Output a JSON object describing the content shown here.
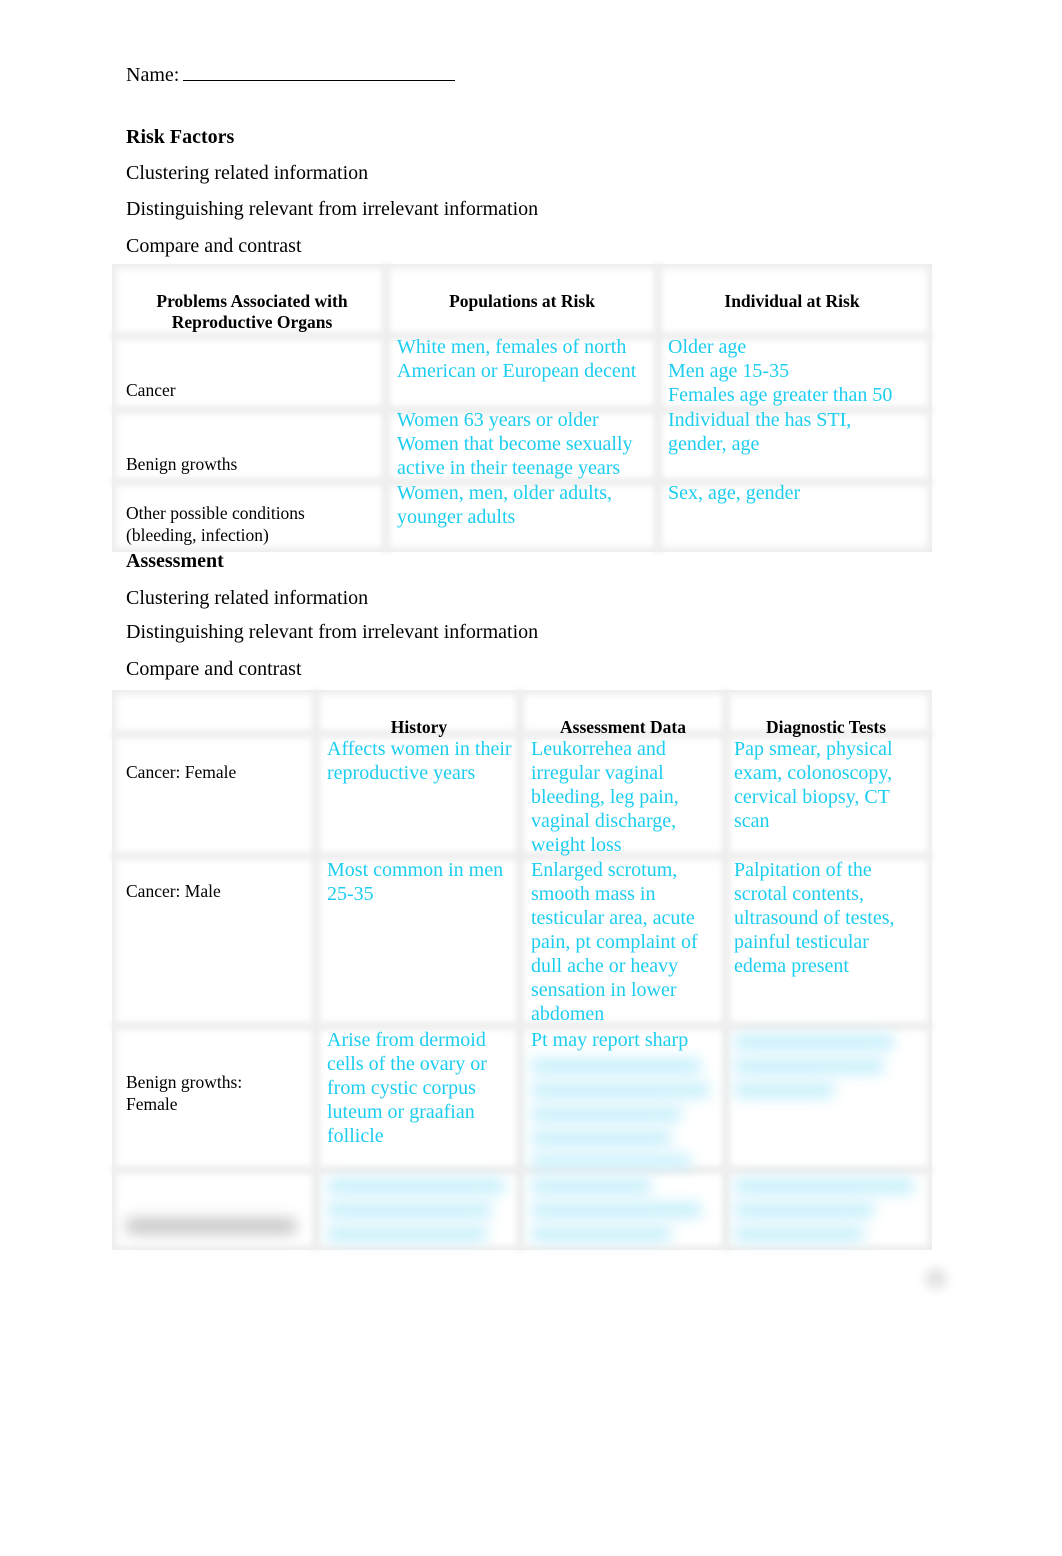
{
  "document": {
    "name_label": "Name:",
    "risk_factors": {
      "heading": "Risk Factors",
      "bullets": [
        "Clustering related information",
        "Distinguishing relevant from irrelevant information",
        "Compare and contrast"
      ],
      "table": {
        "headers": [
          "Problems Associated with Reproductive Organs",
          "Populations at Risk",
          "Individual at Risk"
        ],
        "rows": [
          {
            "problem": "Cancer",
            "populations": [
              "White men, females of north",
              "American or European decent"
            ],
            "individual": [
              "Older age",
              "Men age 15-35",
              "Females age greater than 50"
            ]
          },
          {
            "problem": "Benign growths",
            "populations": [
              "Women 63 years or older",
              "Women that become sexually",
              "active in their teenage years"
            ],
            "individual": [
              "Individual the has STI,",
              "gender, age"
            ]
          },
          {
            "problem": "Other possible conditions (bleeding, infection)",
            "populations": [
              "Women, men, older adults,",
              "younger adults"
            ],
            "individual": [
              "Sex, age, gender"
            ]
          }
        ]
      }
    },
    "assessment": {
      "heading": "Assessment",
      "bullets": [
        "Clustering related information",
        "Distinguishing relevant from irrelevant information",
        "Compare and contrast"
      ],
      "table": {
        "headers": [
          "",
          "History",
          "Assessment Data",
          "Diagnostic Tests"
        ],
        "rows": [
          {
            "condition": "Cancer: Female",
            "history": "Affects women in their reproductive years",
            "assessment": "Leukorrehea and irregular vaginal bleeding, leg pain, vaginal discharge, weight loss",
            "tests": "Pap smear, physical exam, colonoscopy, cervical biopsy, CT scan"
          },
          {
            "condition": "Cancer: Male",
            "history": "Most common in men 25-35",
            "assessment": "Enlarged scrotum, smooth mass in testicular area, acute pain, pt complaint of dull ache or heavy sensation in lower abdomen",
            "tests": "Palpitation of the scrotal contents, ultrasound of testes, painful testicular edema present"
          },
          {
            "condition": "Benign growths: Female",
            "history": "Arise from dermoid cells of the ovary or from cystic corpus luteum or graafian follicle",
            "assessment": "Pt may report sharp",
            "tests": ""
          },
          {
            "condition": "",
            "history": "",
            "assessment": "",
            "tests": ""
          }
        ]
      }
    }
  }
}
